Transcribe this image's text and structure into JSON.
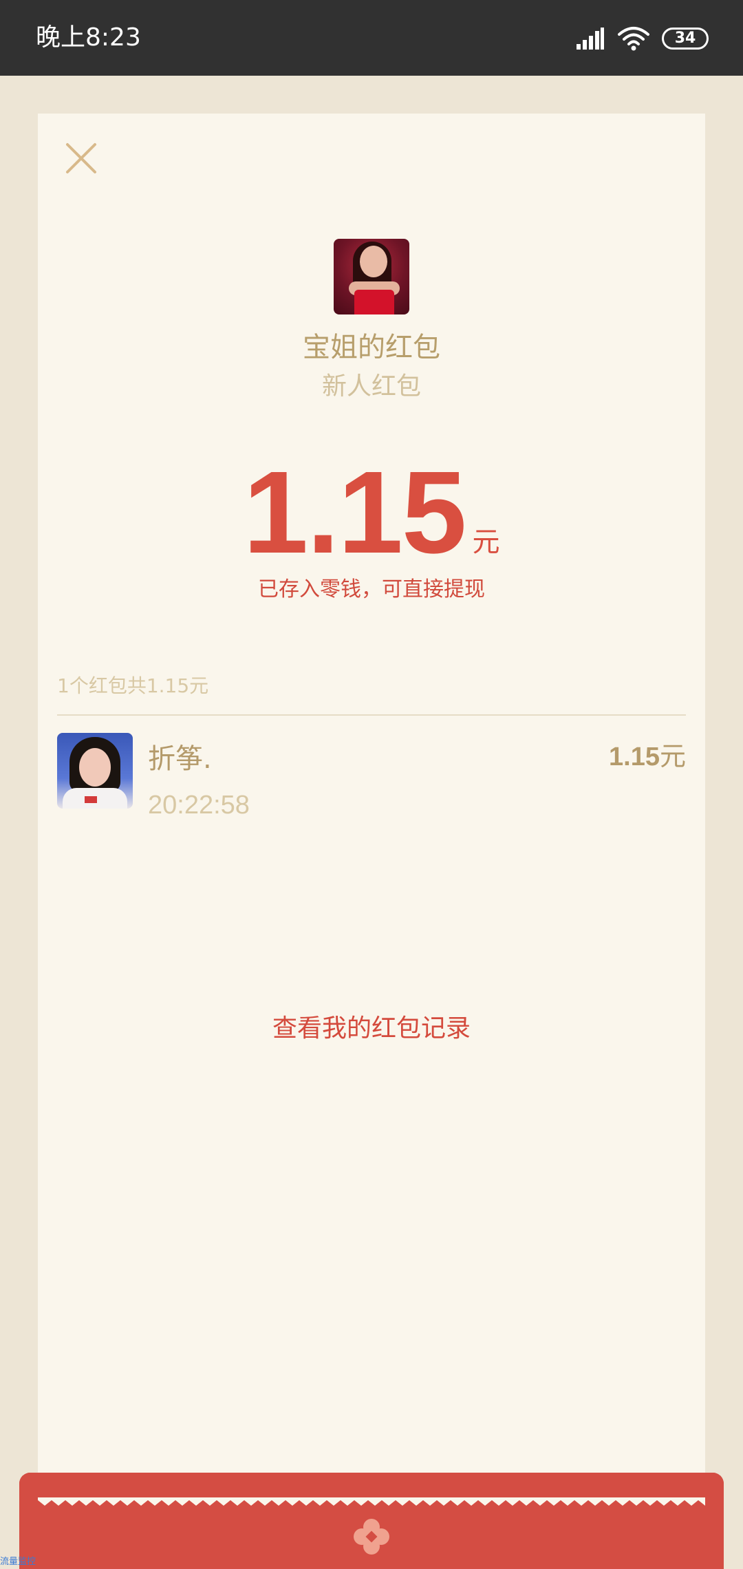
{
  "status_bar": {
    "time": "晚上8:23",
    "battery": "34"
  },
  "sender": {
    "title": "宝姐的红包",
    "subtitle": "新人红包"
  },
  "amount": {
    "value": "1.15",
    "unit": "元",
    "note": "已存入零钱，可直接提现"
  },
  "summary": "1个红包共1.15元",
  "records": [
    {
      "name": "折筝.",
      "time": "20:22:58",
      "amount": "1.15",
      "unit": "元"
    }
  ],
  "history_link": "查看我的红包记录",
  "watermark": "流量监控",
  "colors": {
    "accent_red": "#d94f40",
    "gold": "#b79e6b",
    "card_bg": "#faf6ec",
    "page_bg": "#ede5d5"
  },
  "icons": {
    "close": "close-icon",
    "signal": "signal-icon",
    "wifi": "wifi-icon",
    "envelope_seal": "flower-icon"
  }
}
